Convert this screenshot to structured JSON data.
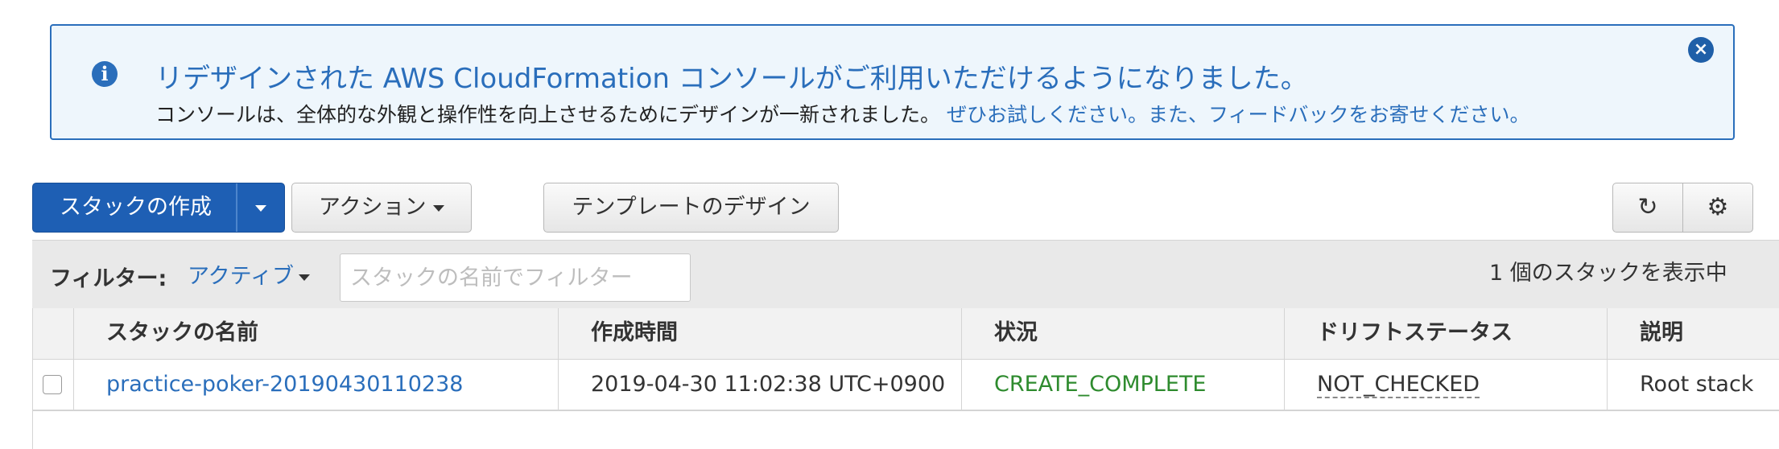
{
  "banner": {
    "title": "リデザインされた AWS CloudFormation コンソールがご利用いただけるようになりました。",
    "message": "コンソールは、全体的な外観と操作性を向上させるためにデザインが一新されました。",
    "link_text": "ぜひお試しください。また、フィードバックをお寄せください。",
    "info_icon_glyph": "i",
    "close_icon_glyph": "×"
  },
  "toolbar": {
    "create_stack_label": "スタックの作成",
    "actions_label": "アクション",
    "design_template_label": "テンプレートのデザイン",
    "refresh_icon_glyph": "↻",
    "gear_icon_glyph": "⚙"
  },
  "filter": {
    "label": "フィルター:",
    "selected": "アクティブ",
    "placeholder": "スタックの名前でフィルター",
    "value": "",
    "count_text": "1 個のスタックを表示中"
  },
  "table": {
    "columns": [
      "スタックの名前",
      "作成時間",
      "状況",
      "ドリフトステータス",
      "説明"
    ],
    "rows": [
      {
        "name": "practice-poker-20190430110238",
        "created": "2019-04-30 11:02:38 UTC+0900",
        "status": "CREATE_COMPLETE",
        "drift": "NOT_CHECKED",
        "description": "Root stack"
      }
    ]
  },
  "colors": {
    "accent": "#2a6ebb",
    "primary_button": "#1e5fb4",
    "status_complete": "#2e8b2e",
    "banner_background": "#eef6fc"
  }
}
